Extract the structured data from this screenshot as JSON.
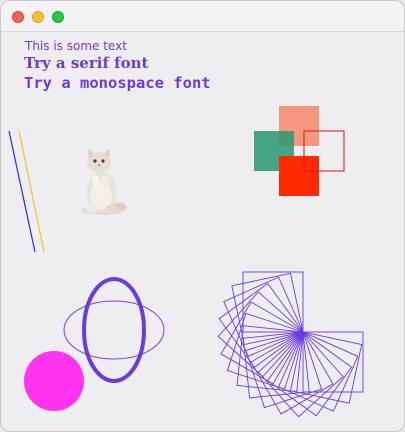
{
  "window": {
    "traffic_lights": {
      "close_color": "#fe5f57",
      "minimize_color": "#febc2e",
      "zoom_color": "#28c840"
    }
  },
  "canvas": {
    "texts": {
      "plain": "This is some text",
      "serif": "Try a serif font",
      "mono": "Try a monospace font"
    },
    "colors": {
      "text": "#6a3be0",
      "line_blue": "#2a2ae8",
      "line_yellow": "#f2c230",
      "square_salmon": "#f4876a",
      "square_teal": "#2f9a74",
      "square_red": "#ff2a00",
      "square_outline": "#d01818",
      "ellipse": "#6a3be0",
      "circle": "#ff33f0",
      "spiral": "#6a3be0"
    },
    "image": {
      "name": "kitten",
      "icon": "kitten-image"
    }
  }
}
